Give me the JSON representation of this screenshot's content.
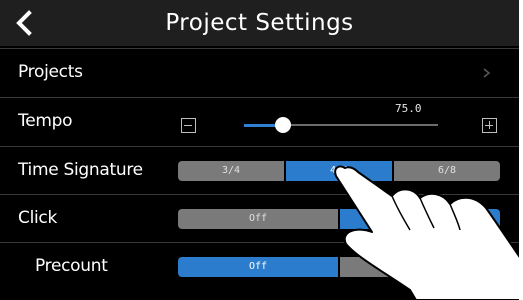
{
  "header": {
    "title": "Project Settings",
    "back_icon": "chevron-left-icon"
  },
  "settings": {
    "projects": {
      "label": "Projects",
      "chevron": ">"
    },
    "tempo": {
      "label": "Tempo",
      "value": "75.0",
      "slider_fraction": 0.2,
      "decrease_icon": "minus-box-icon",
      "increase_icon": "plus-box-icon"
    },
    "time_signature": {
      "label": "Time Signature",
      "options": [
        "3/4",
        "4/4",
        "6/8"
      ],
      "selected": "4/4"
    },
    "click": {
      "label": "Click",
      "options": [
        "Off",
        "On"
      ],
      "selected": "On"
    },
    "precount": {
      "label": "Precount",
      "options": [
        "Off",
        ""
      ],
      "selected": "Off"
    }
  },
  "colors": {
    "accent": "#2c7ccd",
    "segment_inactive": "#7a7a7a",
    "background": "#000000",
    "header": "#1f1f1f"
  }
}
